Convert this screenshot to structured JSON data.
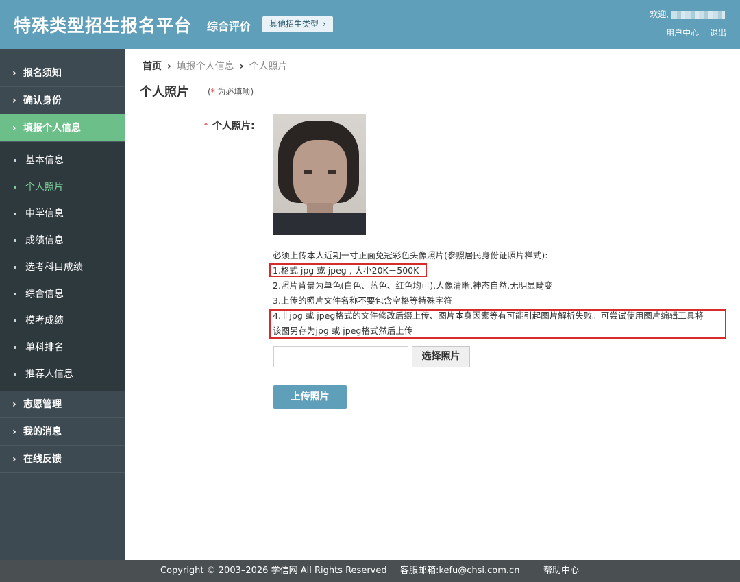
{
  "header": {
    "site_title": "特殊类型招生报名平台",
    "subtitle": "综合评价",
    "other_types_label": "其他招生类型",
    "welcome_label": "欢迎,",
    "user_center": "用户中心",
    "logout": "退出"
  },
  "sidebar": {
    "top_items": [
      {
        "label": "报名须知"
      },
      {
        "label": "确认身份"
      },
      {
        "label": "填报个人信息"
      }
    ],
    "sub_items": [
      {
        "label": "基本信息"
      },
      {
        "label": "个人照片"
      },
      {
        "label": "中学信息"
      },
      {
        "label": "成绩信息"
      },
      {
        "label": "选考科目成绩"
      },
      {
        "label": "综合信息"
      },
      {
        "label": "模考成绩"
      },
      {
        "label": "单科排名"
      },
      {
        "label": "推荐人信息"
      }
    ],
    "bottom_items": [
      {
        "label": "志愿管理"
      },
      {
        "label": "我的消息"
      },
      {
        "label": "在线反馈"
      }
    ]
  },
  "breadcrumb": {
    "home": "首页",
    "step": "填报个人信息",
    "current": "个人照片"
  },
  "page": {
    "title": "个人照片",
    "required_note_star": "*",
    "required_note": "为必填项)",
    "required_note_open": "(",
    "field_label": "个人照片:",
    "field_star": "*"
  },
  "instructions": {
    "intro": "必须上传本人近期一寸正面免冠彩色头像照片(参照居民身份证照片样式):",
    "line1": "1.格式 jpg 或 jpeg , 大小20K－500K",
    "line2": "2.照片背景为单色(白色、蓝色、红色均可),人像清晰,神态自然,无明显畸变",
    "line3": "3.上传的照片文件名称不要包含空格等特殊字符",
    "line4a": "4.非jpg 或 jpeg格式的文件修改后缀上传、图片本身因素等有可能引起图片解析失败。可尝试使用图片编辑工具将",
    "line4b": "该图另存为jpg 或 jpeg格式然后上传"
  },
  "upload": {
    "choose_label": "选择照片",
    "upload_label": "上传照片"
  },
  "footer": {
    "copyright": "Copyright © 2003–2026 学信网 All Rights Reserved",
    "service_mail": "客服邮箱:kefu@chsi.com.cn",
    "help": "帮助中心"
  },
  "colors": {
    "header": "#5f9fba",
    "sidebar": "#3d4a51",
    "active": "#6dbf8a",
    "highlight_border": "#d62c2c"
  }
}
